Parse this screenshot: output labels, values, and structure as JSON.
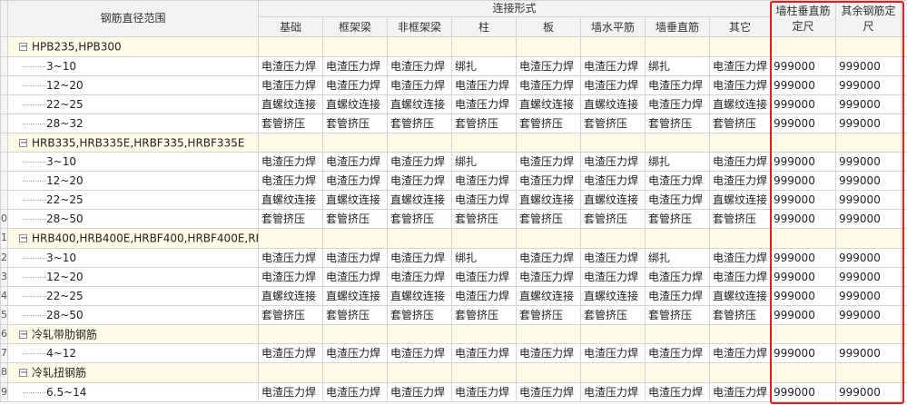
{
  "header": {
    "range_label": "钢筋直径范围",
    "connect_label": "连接形式",
    "columns": [
      "基础",
      "框架梁",
      "非框架梁",
      "柱",
      "板",
      "墙水平筋",
      "墙垂直筋",
      "其它"
    ],
    "fix_vertical": "墙柱垂直筋定尺",
    "fix_other": "其余钢筋定尺"
  },
  "rows": [
    {
      "idx": "",
      "type": "group",
      "name": "HPB235,HPB300"
    },
    {
      "idx": "",
      "type": "item",
      "name": "3~10",
      "cells": [
        "电渣压力焊",
        "电渣压力焊",
        "电渣压力焊",
        "绑扎",
        "电渣压力焊",
        "电渣压力焊",
        "绑扎",
        "电渣压力焊",
        "999000",
        "999000"
      ]
    },
    {
      "idx": "",
      "type": "item",
      "name": "12~20",
      "cells": [
        "电渣压力焊",
        "电渣压力焊",
        "电渣压力焊",
        "电渣压力焊",
        "电渣压力焊",
        "电渣压力焊",
        "电渣压力焊",
        "电渣压力焊",
        "999000",
        "999000"
      ]
    },
    {
      "idx": "",
      "type": "item",
      "name": "22~25",
      "cells": [
        "直螺纹连接",
        "直螺纹连接",
        "直螺纹连接",
        "电渣压力焊",
        "直螺纹连接",
        "直螺纹连接",
        "电渣压力焊",
        "直螺纹连接",
        "999000",
        "999000"
      ]
    },
    {
      "idx": "",
      "type": "item",
      "name": "28~32",
      "cells": [
        "套管挤压",
        "套管挤压",
        "套管挤压",
        "套管挤压",
        "套管挤压",
        "套管挤压",
        "套管挤压",
        "套管挤压",
        "999000",
        "999000"
      ]
    },
    {
      "idx": "",
      "type": "group",
      "name": "HRB335,HRB335E,HRBF335,HRBF335E"
    },
    {
      "idx": "",
      "type": "item",
      "name": "3~10",
      "cells": [
        "电渣压力焊",
        "电渣压力焊",
        "电渣压力焊",
        "绑扎",
        "电渣压力焊",
        "电渣压力焊",
        "绑扎",
        "电渣压力焊",
        "999000",
        "999000"
      ]
    },
    {
      "idx": "",
      "type": "item",
      "name": "12~20",
      "cells": [
        "电渣压力焊",
        "电渣压力焊",
        "电渣压力焊",
        "电渣压力焊",
        "电渣压力焊",
        "电渣压力焊",
        "电渣压力焊",
        "电渣压力焊",
        "999000",
        "999000"
      ]
    },
    {
      "idx": "",
      "type": "item",
      "name": "22~25",
      "cells": [
        "直螺纹连接",
        "直螺纹连接",
        "直螺纹连接",
        "电渣压力焊",
        "直螺纹连接",
        "直螺纹连接",
        "电渣压力焊",
        "直螺纹连接",
        "999000",
        "999000"
      ]
    },
    {
      "idx": "0",
      "type": "item",
      "name": "28~50",
      "cells": [
        "套管挤压",
        "套管挤压",
        "套管挤压",
        "套管挤压",
        "套管挤压",
        "套管挤压",
        "套管挤压",
        "套管挤压",
        "999000",
        "999000"
      ]
    },
    {
      "idx": "1",
      "type": "group",
      "name": "HRB400,HRB400E,HRBF400,HRBF400E,RR…"
    },
    {
      "idx": "2",
      "type": "item",
      "name": "3~10",
      "cells": [
        "电渣压力焊",
        "电渣压力焊",
        "电渣压力焊",
        "绑扎",
        "电渣压力焊",
        "电渣压力焊",
        "绑扎",
        "电渣压力焊",
        "999000",
        "999000"
      ]
    },
    {
      "idx": "3",
      "type": "item",
      "name": "12~20",
      "cells": [
        "电渣压力焊",
        "电渣压力焊",
        "电渣压力焊",
        "电渣压力焊",
        "电渣压力焊",
        "电渣压力焊",
        "电渣压力焊",
        "电渣压力焊",
        "999000",
        "999000"
      ]
    },
    {
      "idx": "4",
      "type": "item",
      "name": "22~25",
      "cells": [
        "直螺纹连接",
        "直螺纹连接",
        "直螺纹连接",
        "电渣压力焊",
        "直螺纹连接",
        "直螺纹连接",
        "电渣压力焊",
        "直螺纹连接",
        "999000",
        "999000"
      ]
    },
    {
      "idx": "5",
      "type": "item",
      "name": "28~50",
      "cells": [
        "套管挤压",
        "套管挤压",
        "套管挤压",
        "套管挤压",
        "套管挤压",
        "套管挤压",
        "套管挤压",
        "套管挤压",
        "999000",
        "999000"
      ]
    },
    {
      "idx": "6",
      "type": "group",
      "name": "冷轧带肋钢筋"
    },
    {
      "idx": "7",
      "type": "item",
      "name": "4~12",
      "cells": [
        "电渣压力焊",
        "电渣压力焊",
        "电渣压力焊",
        "电渣压力焊",
        "电渣压力焊",
        "电渣压力焊",
        "电渣压力焊",
        "电渣压力焊",
        "999000",
        "999000"
      ]
    },
    {
      "idx": "8",
      "type": "group",
      "name": "冷轧扭钢筋"
    },
    {
      "idx": "9",
      "type": "item",
      "name": "6.5~14",
      "cells": [
        "电渣压力焊",
        "电渣压力焊",
        "电渣压力焊",
        "电渣压力焊",
        "电渣压力焊",
        "电渣压力焊",
        "电渣压力焊",
        "电渣压力焊",
        "999000",
        "999000"
      ]
    }
  ],
  "toggle_symbol": "−",
  "accent": "#e31d1d"
}
